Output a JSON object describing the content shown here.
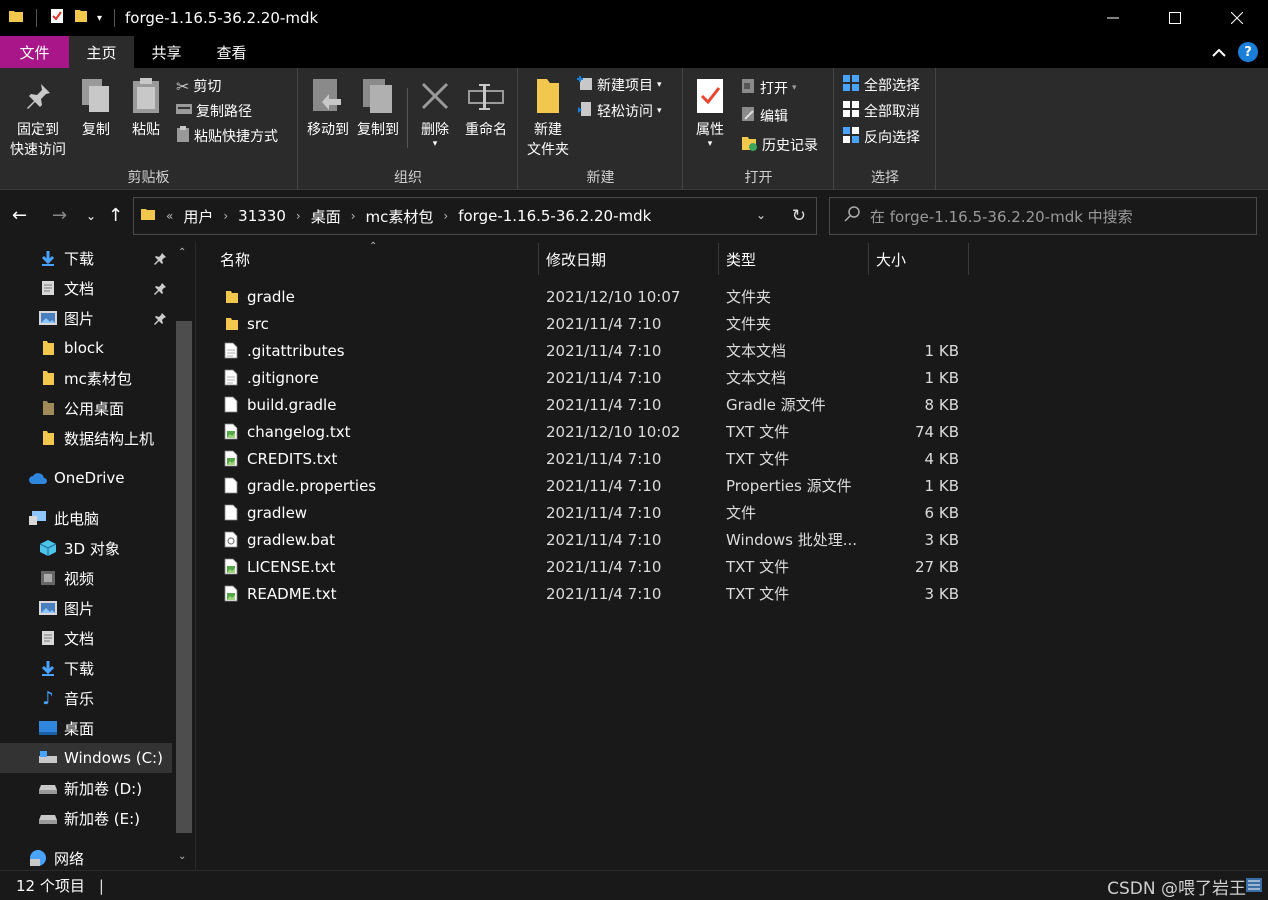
{
  "window": {
    "title": "forge-1.16.5-36.2.20-mdk",
    "controls": [
      "minimize-icon",
      "maximize-icon",
      "close-icon"
    ]
  },
  "menu": {
    "tabs": [
      "文件",
      "主页",
      "共享",
      "查看"
    ],
    "active": "主页"
  },
  "ribbon": {
    "clipboard": {
      "label": "剪贴板",
      "pin_quick_access": "固定到\n快速访问",
      "pin_line1": "固定到",
      "pin_line2": "快速访问",
      "copy": "复制",
      "paste": "粘贴",
      "cut": "剪切",
      "copy_path": "复制路径",
      "paste_shortcut": "粘贴快捷方式"
    },
    "organize": {
      "label": "组织",
      "move_to": "移动到",
      "copy_to": "复制到",
      "delete": "删除",
      "rename": "重命名"
    },
    "new": {
      "label": "新建",
      "new_folder_line1": "新建",
      "new_folder_line2": "文件夹",
      "new_item": "新建项目",
      "easy_access": "轻松访问"
    },
    "open": {
      "label": "打开",
      "properties": "属性",
      "open": "打开",
      "edit": "编辑",
      "history": "历史记录"
    },
    "select": {
      "label": "选择",
      "select_all": "全部选择",
      "select_none": "全部取消",
      "invert": "反向选择"
    }
  },
  "address": {
    "crumbs": [
      "用户",
      "31330",
      "桌面",
      "mc素材包",
      "forge-1.16.5-36.2.20-mdk"
    ],
    "search_placeholder": "在 forge-1.16.5-36.2.20-mdk 中搜索"
  },
  "sidebar": {
    "quick_access": [
      {
        "label": "下载",
        "icon": "download-icon",
        "pinned": true
      },
      {
        "label": "文档",
        "icon": "document-icon",
        "pinned": true
      },
      {
        "label": "图片",
        "icon": "picture-icon",
        "pinned": true
      },
      {
        "label": "block",
        "icon": "folder-icon",
        "pinned": false
      },
      {
        "label": "mc素材包",
        "icon": "folder-icon",
        "pinned": false
      },
      {
        "label": "公用桌面",
        "icon": "folder-icon",
        "pinned": false
      },
      {
        "label": "数据结构上机",
        "icon": "folder-icon",
        "pinned": false
      }
    ],
    "onedrive": "OneDrive",
    "this_pc": "此电脑",
    "pc_items": [
      {
        "label": "3D 对象",
        "icon": "cube-icon"
      },
      {
        "label": "视频",
        "icon": "video-icon"
      },
      {
        "label": "图片",
        "icon": "picture-icon"
      },
      {
        "label": "文档",
        "icon": "document-icon"
      },
      {
        "label": "下载",
        "icon": "download-icon"
      },
      {
        "label": "音乐",
        "icon": "music-icon"
      },
      {
        "label": "桌面",
        "icon": "desktop-icon"
      },
      {
        "label": "Windows (C:)",
        "icon": "drive-icon"
      },
      {
        "label": "新加卷 (D:)",
        "icon": "drive-icon"
      },
      {
        "label": "新加卷 (E:)",
        "icon": "drive-icon"
      }
    ],
    "network": "网络"
  },
  "columns": {
    "name": "名称",
    "date": "修改日期",
    "type": "类型",
    "size": "大小"
  },
  "files": [
    {
      "name": "gradle",
      "date": "2021/12/10 10:07",
      "type": "文件夹",
      "size": "",
      "icon": "folder-icon"
    },
    {
      "name": "src",
      "date": "2021/11/4 7:10",
      "type": "文件夹",
      "size": "",
      "icon": "folder-icon"
    },
    {
      "name": ".gitattributes",
      "date": "2021/11/4 7:10",
      "type": "文本文档",
      "size": "1 KB",
      "icon": "text-file-icon"
    },
    {
      "name": ".gitignore",
      "date": "2021/11/4 7:10",
      "type": "文本文档",
      "size": "1 KB",
      "icon": "text-file-icon"
    },
    {
      "name": "build.gradle",
      "date": "2021/11/4 7:10",
      "type": "Gradle 源文件",
      "size": "8 KB",
      "icon": "file-icon"
    },
    {
      "name": "changelog.txt",
      "date": "2021/12/10 10:02",
      "type": "TXT 文件",
      "size": "74 KB",
      "icon": "txt-file-icon"
    },
    {
      "name": "CREDITS.txt",
      "date": "2021/11/4 7:10",
      "type": "TXT 文件",
      "size": "4 KB",
      "icon": "txt-file-icon"
    },
    {
      "name": "gradle.properties",
      "date": "2021/11/4 7:10",
      "type": "Properties 源文件",
      "size": "1 KB",
      "icon": "file-icon"
    },
    {
      "name": "gradlew",
      "date": "2021/11/4 7:10",
      "type": "文件",
      "size": "6 KB",
      "icon": "file-icon"
    },
    {
      "name": "gradlew.bat",
      "date": "2021/11/4 7:10",
      "type": "Windows 批处理...",
      "size": "3 KB",
      "icon": "bat-file-icon"
    },
    {
      "name": "LICENSE.txt",
      "date": "2021/11/4 7:10",
      "type": "TXT 文件",
      "size": "27 KB",
      "icon": "txt-file-icon"
    },
    {
      "name": "README.txt",
      "date": "2021/11/4 7:10",
      "type": "TXT 文件",
      "size": "3 KB",
      "icon": "txt-file-icon"
    }
  ],
  "status": {
    "count": "12 个项目",
    "watermark": "CSDN @喂了岩王"
  },
  "colors": {
    "file_tab": "#a8168a",
    "folder": "#f2c74e",
    "accent_blue": "#1a7fd9"
  }
}
